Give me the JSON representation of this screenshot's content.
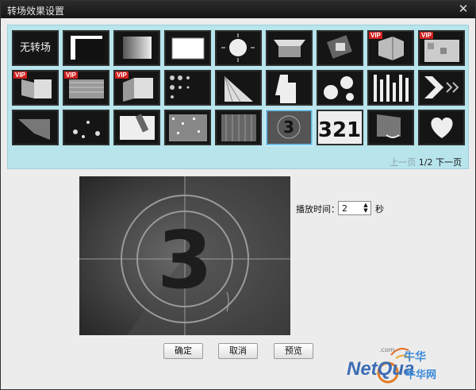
{
  "window": {
    "title": "转场效果设置",
    "close_glyph": "✕"
  },
  "gallery": {
    "none_label": "无转场",
    "vip_label": "VIP",
    "countdown_number": "3",
    "counter_text": "321",
    "selected_index": 23,
    "items": [
      {
        "name": "none"
      },
      {
        "name": "shrink-window"
      },
      {
        "name": "fade-gradient"
      },
      {
        "name": "frame-slide"
      },
      {
        "name": "zoom-arrows"
      },
      {
        "name": "lift-page"
      },
      {
        "name": "rotate-squares"
      },
      {
        "name": "cube",
        "vip": true
      },
      {
        "name": "mosaic",
        "vip": true
      },
      {
        "name": "fold-left",
        "vip": true
      },
      {
        "name": "blinds-blur",
        "vip": true
      },
      {
        "name": "page-flip",
        "vip": true
      },
      {
        "name": "dots-dissolve"
      },
      {
        "name": "fan-sweep"
      },
      {
        "name": "step-wipe"
      },
      {
        "name": "circle-bubbles"
      },
      {
        "name": "bar-stripes"
      },
      {
        "name": "chevron-arrows"
      },
      {
        "name": "page-curl"
      },
      {
        "name": "sparkle-bokeh"
      },
      {
        "name": "paint-brush"
      },
      {
        "name": "noise-static"
      },
      {
        "name": "curtain"
      },
      {
        "name": "countdown-3"
      },
      {
        "name": "countdown-321"
      },
      {
        "name": "rotate-arrow"
      },
      {
        "name": "heart"
      }
    ]
  },
  "pager": {
    "prev": "上一页",
    "current": "1",
    "total": "/2",
    "next": "下一页"
  },
  "duration": {
    "label": "播放时间：",
    "value": "2",
    "unit": "秒"
  },
  "buttons": {
    "ok": "确定",
    "cancel": "取消",
    "preview": "预览"
  },
  "watermark": {
    "brand": "NetQua",
    "cn_top": "牛华",
    "cn_bottom": "牛华网",
    "com": ".com"
  }
}
